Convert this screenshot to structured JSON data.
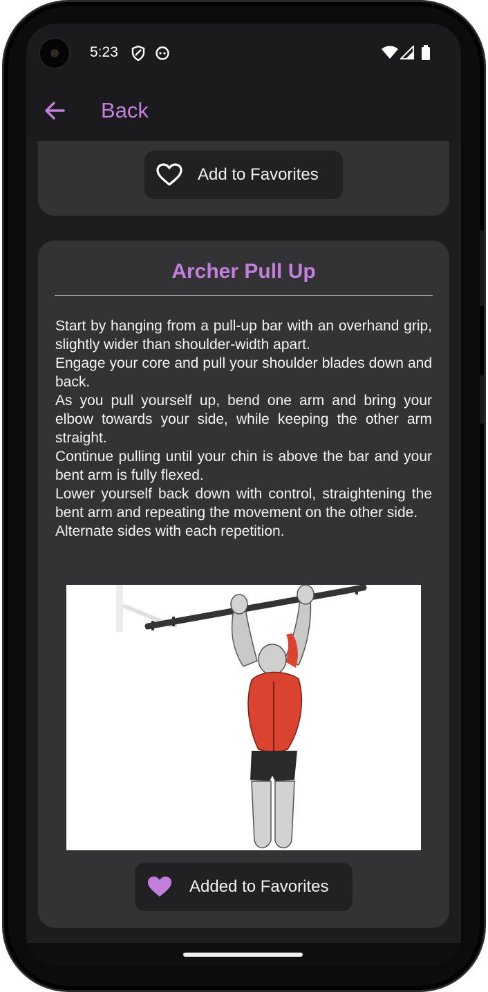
{
  "status_bar": {
    "time": "5:23",
    "icons": [
      "shield-icon",
      "face-icon",
      "wifi-icon",
      "signal-icon",
      "battery-icon"
    ]
  },
  "app_bar": {
    "back_label": "Back",
    "back_icon": "arrow-left-icon"
  },
  "previous_card": {
    "favorite_label": "Add to Favorites",
    "favorite_icon": "heart-outline-icon"
  },
  "exercise": {
    "title": "Archer Pull Up",
    "steps": [
      "Start by hanging from a pull-up bar with an overhand grip, slightly wider than shoulder-width apart.",
      "Engage your core and pull your shoulder blades down and back.",
      "As you pull yourself up, bend one arm and bring your elbow towards your side, while keeping the other arm straight.",
      "Continue pulling until your chin is above the bar and your bent arm is fully flexed.",
      "Lower yourself back down with control, straightening the bent arm and repeating the movement on the other side.",
      "Alternate sides with each repetition."
    ],
    "favorite_label": "Added to Favorites",
    "favorite_icon": "heart-filled-icon"
  },
  "colors": {
    "accent": "#c27fdc",
    "card_bg": "#333335",
    "screen_bg": "#1d1d1f",
    "muscle_highlight": "#d9432f"
  }
}
